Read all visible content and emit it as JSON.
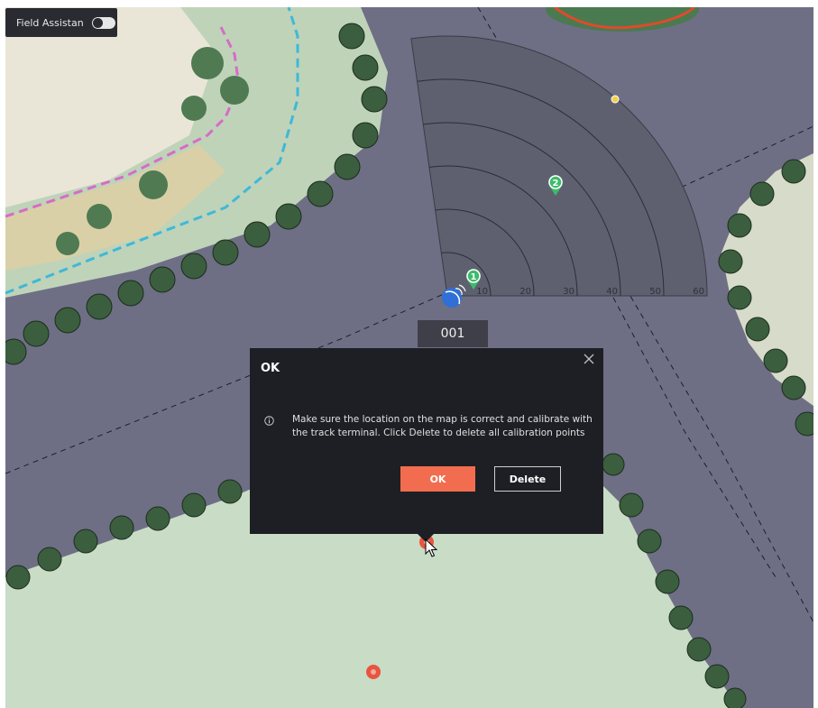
{
  "field_assistant": {
    "label": "Field Assistan",
    "enabled": false
  },
  "radar": {
    "range_labels": [
      "10",
      "20",
      "30",
      "40",
      "50",
      "60"
    ]
  },
  "markers": {
    "calibration_point_1": "1",
    "calibration_point_2": "2"
  },
  "device": {
    "label": "001"
  },
  "dialog": {
    "title": "OK",
    "message": "Make sure the location on the map is correct and calibrate with the track terminal. Click Delete to delete all calibration points",
    "ok_label": "OK",
    "delete_label": "Delete"
  },
  "colors": {
    "road": "#6e6f85",
    "radar_fill": "#5e6070",
    "dialog_bg": "#1e1f24",
    "ok_button": "#f26d4f",
    "marker_green": "#3dbb6a",
    "marker_red": "#e8553e",
    "lawn": "#c9dcc6"
  }
}
